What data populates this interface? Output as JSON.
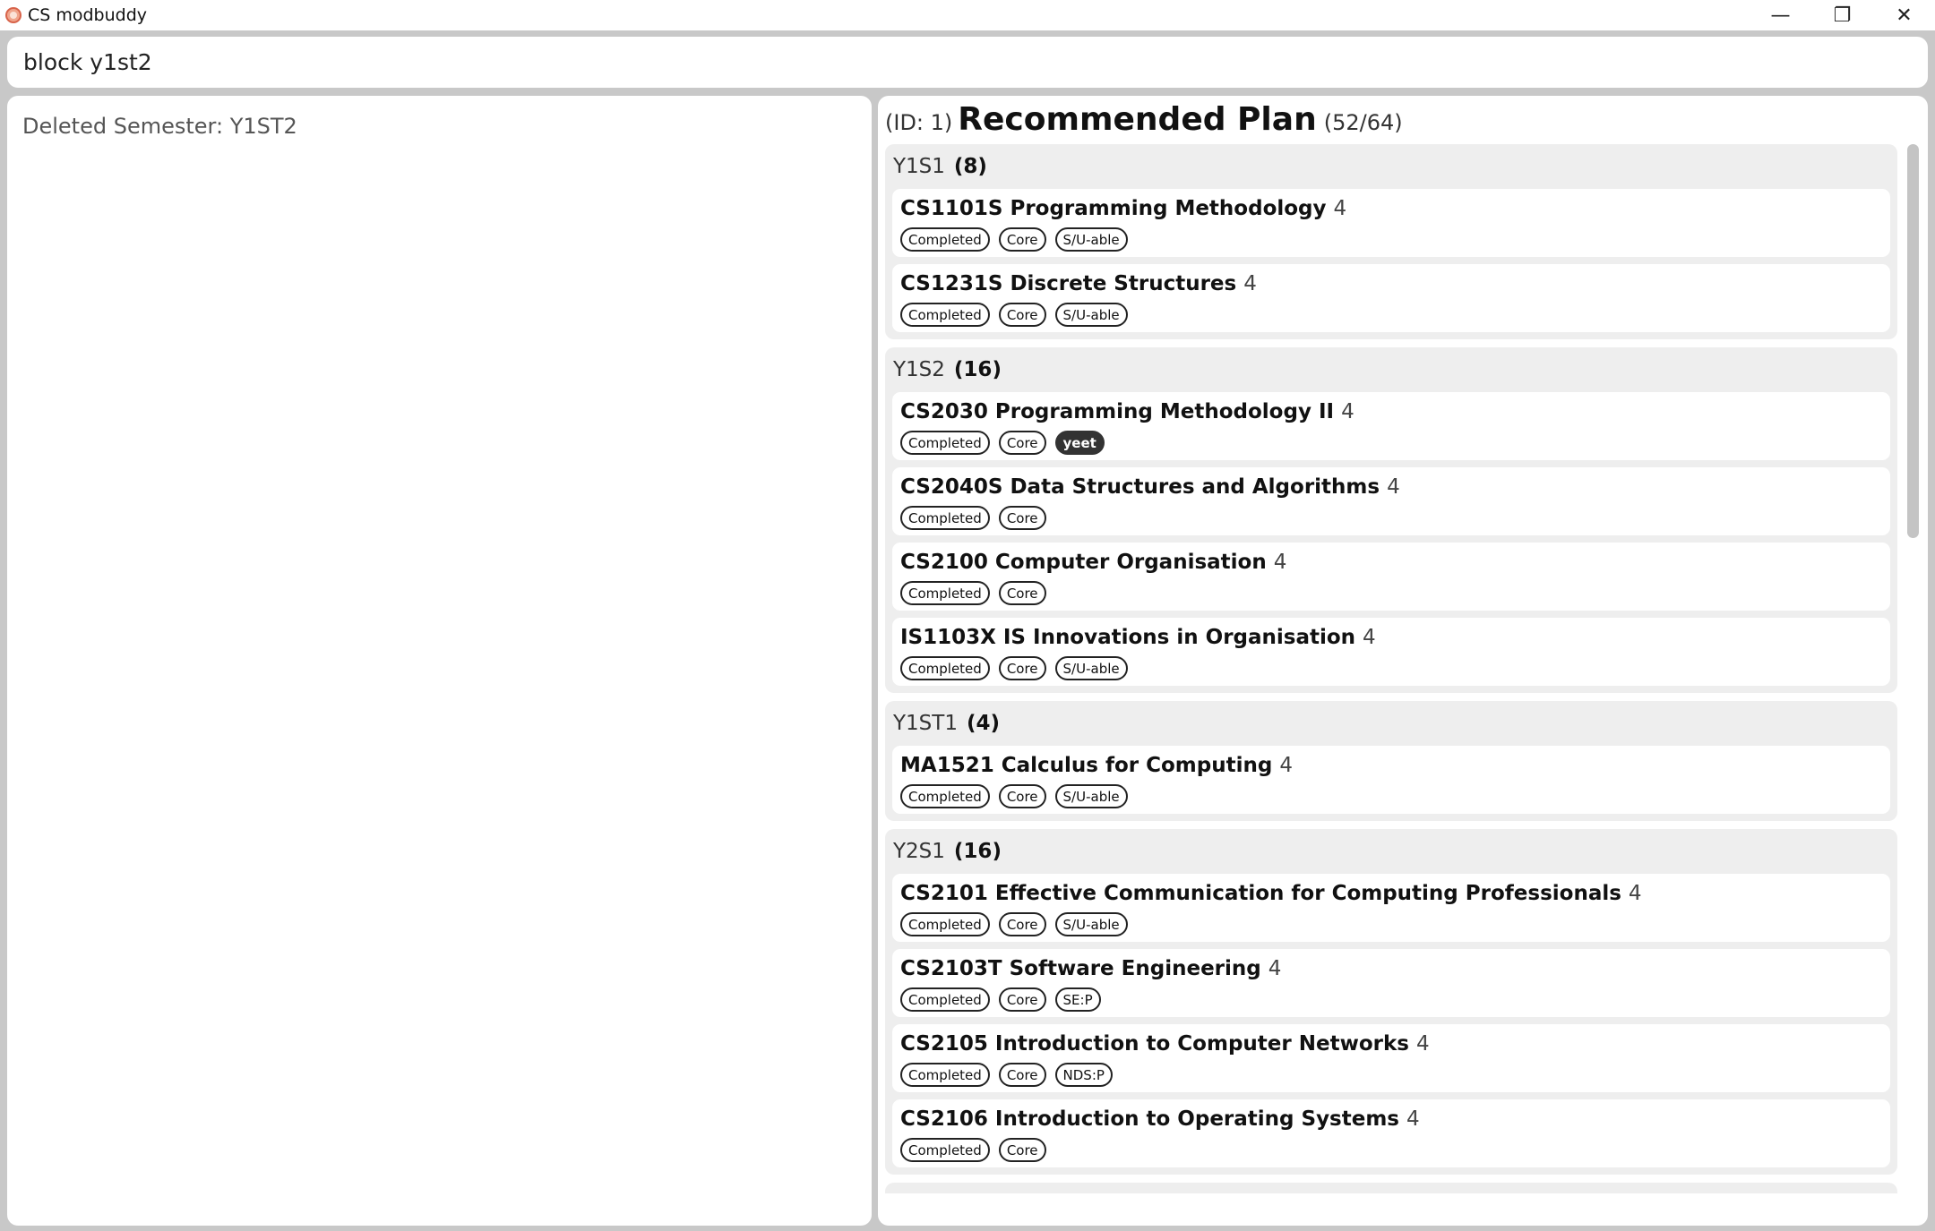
{
  "window": {
    "title": "CS modbuddy",
    "controls": [
      "—",
      "❐",
      "✕"
    ]
  },
  "command": {
    "value": "block y1st2"
  },
  "result": {
    "text": "Deleted Semester: Y1ST2"
  },
  "plan": {
    "id_label": "(ID: 1)",
    "name": "Recommended Plan",
    "credits": "(52/64)",
    "semesters": [
      {
        "name": "Y1S1",
        "credits": "(8)",
        "modules": [
          {
            "title": "CS1101S Programming Methodology",
            "credits": "4",
            "tags": [
              {
                "label": "Completed"
              },
              {
                "label": "Core"
              },
              {
                "label": "S/U-able"
              }
            ]
          },
          {
            "title": "CS1231S Discrete Structures",
            "credits": "4",
            "tags": [
              {
                "label": "Completed"
              },
              {
                "label": "Core"
              },
              {
                "label": "S/U-able"
              }
            ]
          }
        ]
      },
      {
        "name": "Y1S2",
        "credits": "(16)",
        "modules": [
          {
            "title": "CS2030 Programming Methodology II",
            "credits": "4",
            "tags": [
              {
                "label": "Completed"
              },
              {
                "label": "Core"
              },
              {
                "label": "yeet",
                "style": "dark"
              }
            ]
          },
          {
            "title": "CS2040S Data Structures and Algorithms",
            "credits": "4",
            "tags": [
              {
                "label": "Completed"
              },
              {
                "label": "Core"
              }
            ]
          },
          {
            "title": "CS2100 Computer Organisation",
            "credits": "4",
            "tags": [
              {
                "label": "Completed"
              },
              {
                "label": "Core"
              }
            ]
          },
          {
            "title": "IS1103X IS Innovations in Organisation",
            "credits": "4",
            "tags": [
              {
                "label": "Completed"
              },
              {
                "label": "Core"
              },
              {
                "label": "S/U-able"
              }
            ]
          }
        ]
      },
      {
        "name": "Y1ST1",
        "credits": "(4)",
        "modules": [
          {
            "title": "MA1521 Calculus for Computing",
            "credits": "4",
            "tags": [
              {
                "label": "Completed"
              },
              {
                "label": "Core"
              },
              {
                "label": "S/U-able"
              }
            ]
          }
        ]
      },
      {
        "name": "Y2S1",
        "credits": "(16)",
        "modules": [
          {
            "title": "CS2101 Effective Communication for Computing Professionals",
            "credits": "4",
            "tags": [
              {
                "label": "Completed"
              },
              {
                "label": "Core"
              },
              {
                "label": "S/U-able"
              }
            ]
          },
          {
            "title": "CS2103T Software Engineering",
            "credits": "4",
            "tags": [
              {
                "label": "Completed"
              },
              {
                "label": "Core"
              },
              {
                "label": "SE:P"
              }
            ]
          },
          {
            "title": "CS2105 Introduction to Computer Networks",
            "credits": "4",
            "tags": [
              {
                "label": "Completed"
              },
              {
                "label": "Core"
              },
              {
                "label": "NDS:P"
              }
            ]
          },
          {
            "title": "CS2106 Introduction to Operating Systems",
            "credits": "4",
            "tags": [
              {
                "label": "Completed"
              },
              {
                "label": "Core"
              }
            ]
          }
        ]
      }
    ]
  },
  "colors": {
    "background": "#c8c8c8",
    "panel": "#ffffff",
    "semester_bg": "#eeeeee",
    "dark_tag": "#333333"
  }
}
